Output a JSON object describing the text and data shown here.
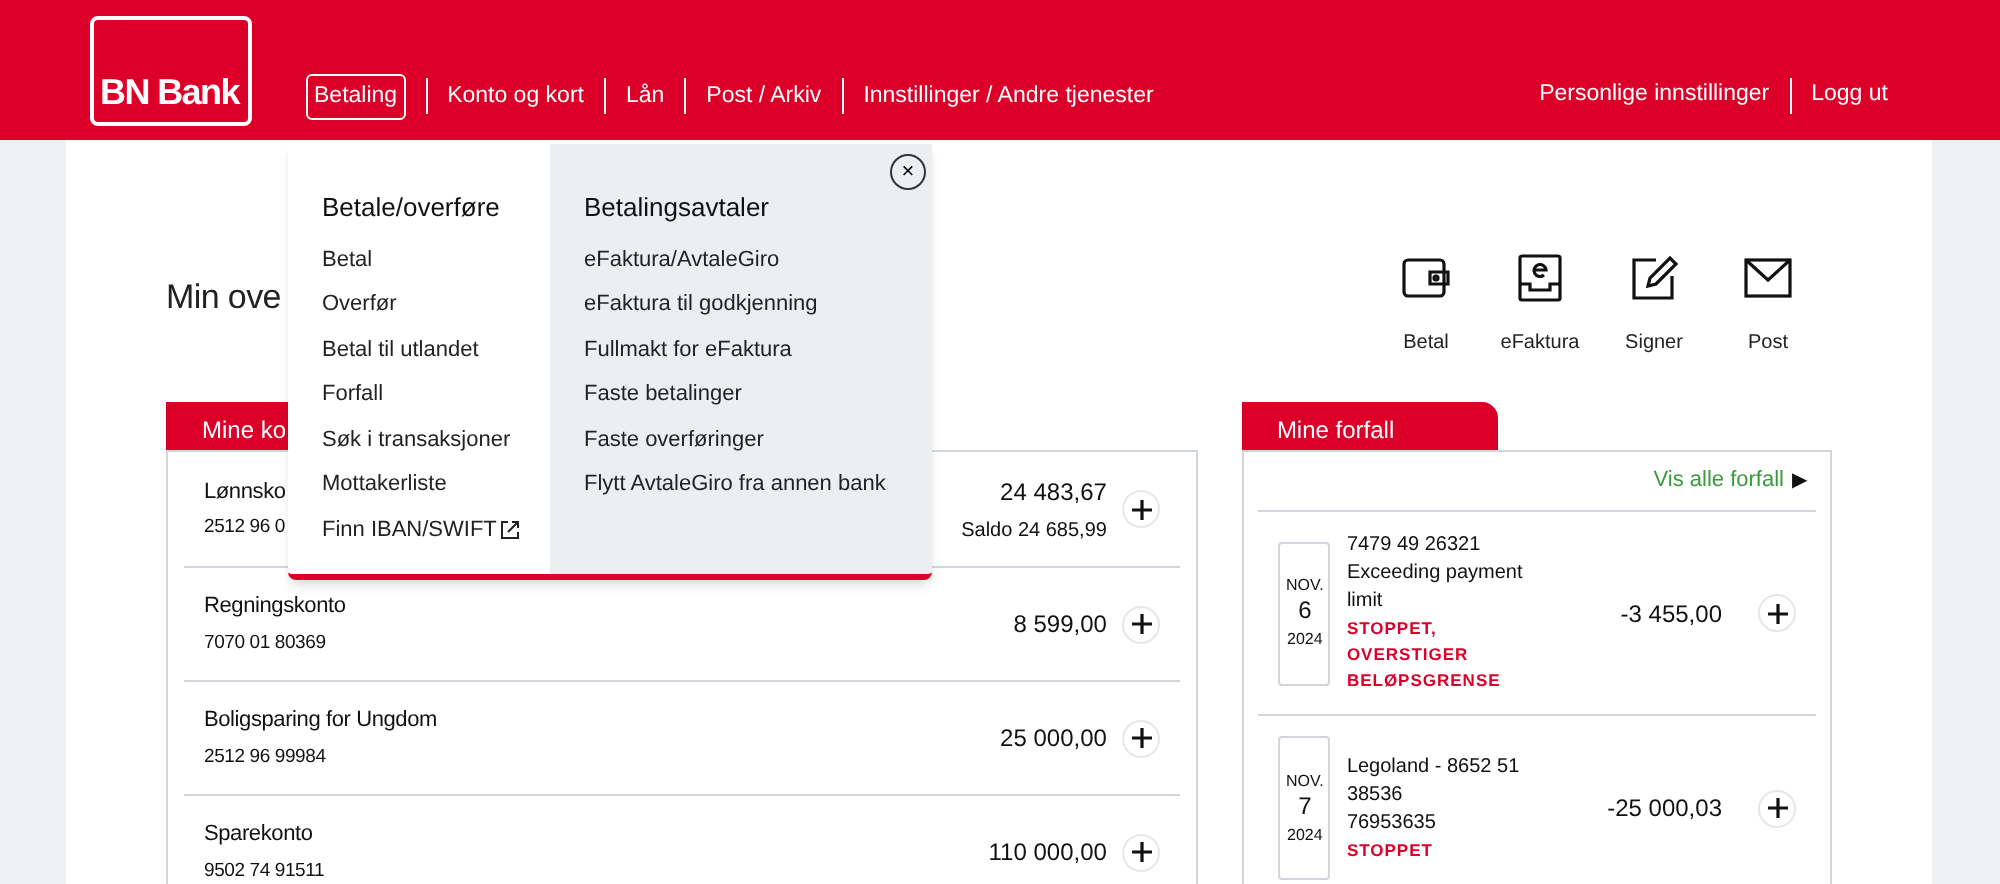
{
  "header": {
    "logo": "BN Bank",
    "nav": [
      {
        "label": "Betaling",
        "selected": true
      },
      {
        "label": "Konto og kort",
        "selected": false
      },
      {
        "label": "Lån",
        "selected": false
      },
      {
        "label": "Post / Arkiv",
        "selected": false
      },
      {
        "label": "Innstillinger / Andre tjenester",
        "selected": false
      }
    ],
    "right_links": [
      "Personlige innstillinger",
      "Logg ut"
    ]
  },
  "page_title": "Min ove",
  "quick_actions": [
    {
      "kind": "wallet",
      "label": "Betal"
    },
    {
      "kind": "efaktura",
      "label": "eFaktura"
    },
    {
      "kind": "sign",
      "label": "Signer"
    },
    {
      "kind": "mail",
      "label": "Post"
    }
  ],
  "accounts": {
    "tab": "Mine ko",
    "rows": [
      {
        "name": "Lønnsko",
        "number": "2512 96 0",
        "amount": "24 483,67",
        "balance": "Saldo 24 685,99"
      },
      {
        "name": "Regningskonto",
        "number": "7070 01 80369",
        "amount": "8 599,00"
      },
      {
        "name": "Boligsparing for Ungdom",
        "number": "2512 96 99984",
        "amount": "25 000,00"
      },
      {
        "name": "Sparekonto",
        "number": "9502 74 91511",
        "amount": "110 000,00"
      }
    ]
  },
  "due": {
    "tab": "Mine forfall",
    "link": "Vis alle forfall",
    "link_arrow": "▶",
    "items": [
      {
        "month": "NOV.",
        "day": "6",
        "year": "2024",
        "lines": [
          "7479 49 26321",
          "Exceeding payment limit"
        ],
        "status": "STOPPET, OVERSTIGER BELØPSGRENSE",
        "amount": "-3 455,00"
      },
      {
        "month": "NOV.",
        "day": "7",
        "year": "2024",
        "lines": [
          "Legoland - 8652 51 38536",
          "76953635"
        ],
        "status": "STOPPET",
        "amount": "-25 000,03"
      }
    ]
  },
  "dropdown": {
    "close": "×",
    "columns": [
      {
        "heading": "Betale/overføre",
        "items": [
          {
            "label": "Betal",
            "external": false
          },
          {
            "label": "Overfør",
            "external": false
          },
          {
            "label": "Betal til utlandet",
            "external": false
          },
          {
            "label": "Forfall",
            "external": false
          },
          {
            "label": "Søk i transaksjoner",
            "external": false
          },
          {
            "label": "Mottakerliste",
            "external": false
          },
          {
            "label": "Finn IBAN/SWIFT",
            "external": true
          }
        ]
      },
      {
        "heading": "Betalingsavtaler",
        "items": [
          {
            "label": "eFaktura/AvtaleGiro",
            "external": false
          },
          {
            "label": "eFaktura til godkjenning",
            "external": false
          },
          {
            "label": "Fullmakt for eFaktura",
            "external": false
          },
          {
            "label": "Faste betalinger",
            "external": false
          },
          {
            "label": "Faste overføringer",
            "external": false
          },
          {
            "label": "Flytt AvtaleGiro fra annen bank",
            "external": false
          }
        ]
      }
    ]
  }
}
